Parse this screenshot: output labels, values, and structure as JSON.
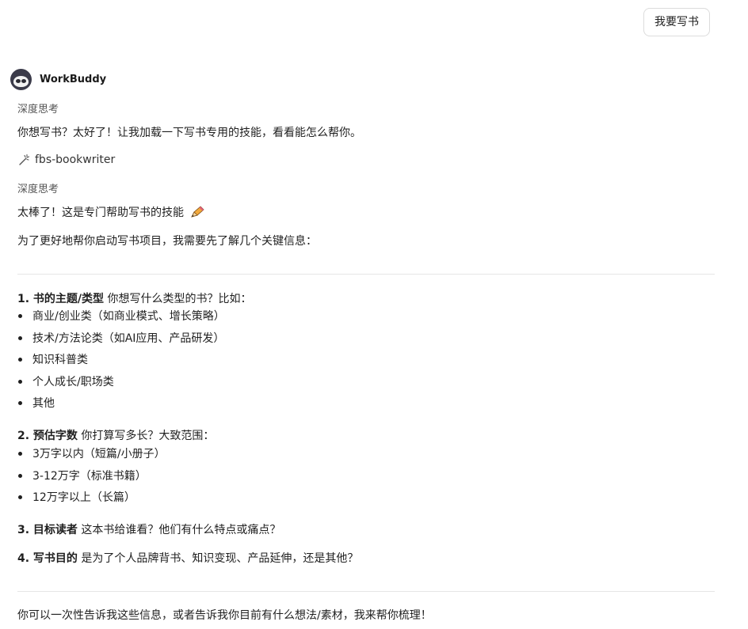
{
  "user_message": "我要写书",
  "bot": {
    "name": "WorkBuddy",
    "avatar_icon": "raccoon-avatar-icon"
  },
  "conversation": {
    "think_1": "深度思考",
    "msg_1": "你想写书？太好了！让我加载一下写书专用的技能，看看能怎么帮你。",
    "tool_icon": "magic-wand-icon",
    "tool_name": "fbs-bookwriter",
    "think_2": "深度思考",
    "msg_2": "太棒了！这是专门帮助写书的技能",
    "msg_2_icon": "pencil-icon",
    "msg_3": "为了更好地帮你启动写书项目，我需要先了解几个关键信息：",
    "q1": {
      "title": "1. 书的主题/类型",
      "text": " 你想写什么类型的书？比如：",
      "options": [
        "商业/创业类（如商业模式、增长策略）",
        "技术/方法论类（如AI应用、产品研发）",
        "知识科普类",
        "个人成长/职场类",
        "其他"
      ]
    },
    "q2": {
      "title": "2. 预估字数",
      "text": " 你打算写多长？大致范围：",
      "options": [
        "3万字以内（短篇/小册子）",
        "3-12万字（标准书籍）",
        "12万字以上（长篇）"
      ]
    },
    "q3": {
      "title": "3. 目标读者",
      "text": " 这本书给谁看？他们有什么特点或痛点？"
    },
    "q4": {
      "title": "4. 写书目的",
      "text": " 是为了个人品牌背书、知识变现、产品延伸，还是其他？"
    },
    "closing": "你可以一次性告诉我这些信息，或者告诉我你目前有什么想法/素材，我来帮你梳理！"
  }
}
